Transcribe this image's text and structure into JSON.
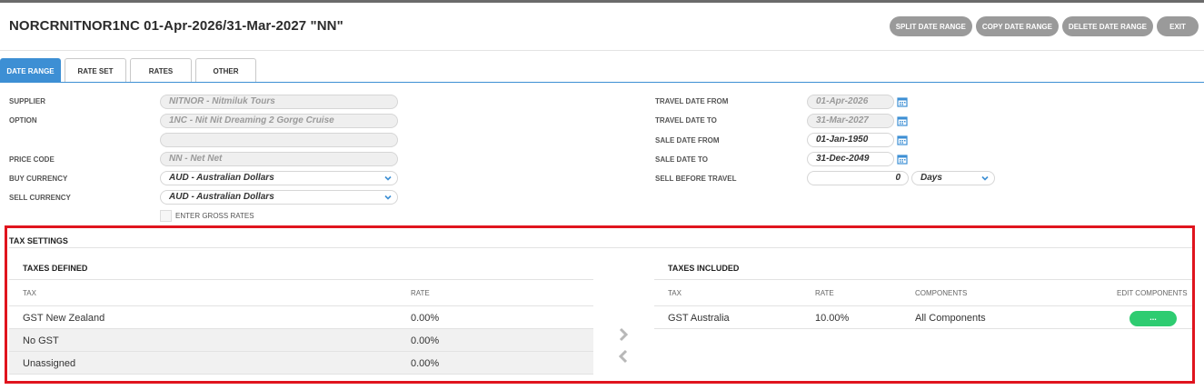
{
  "header": {
    "title": "NORCRNITNOR1NC 01-Apr-2026/31-Mar-2027 \"NN\"",
    "buttons": {
      "split": "SPLIT DATE RANGE",
      "copy": "COPY DATE RANGE",
      "delete": "DELETE DATE RANGE",
      "exit": "EXIT"
    }
  },
  "tabs": [
    "DATE RANGE",
    "RATE SET",
    "RATES",
    "OTHER"
  ],
  "form": {
    "supplier_label": "SUPPLIER",
    "supplier_value": "NITNOR - Nitmiluk Tours",
    "option_label": "OPTION",
    "option_value": "1NC - Nit Nit Dreaming 2 Gorge Cruise",
    "option_extra_value": "",
    "price_code_label": "PRICE CODE",
    "price_code_value": "NN - Net Net",
    "buy_currency_label": "BUY CURRENCY",
    "buy_currency_value": "AUD - Australian Dollars",
    "sell_currency_label": "SELL CURRENCY",
    "sell_currency_value": "AUD - Australian Dollars",
    "gross_rates_label": "ENTER GROSS RATES",
    "travel_from_label": "TRAVEL DATE FROM",
    "travel_from_value": "01-Apr-2026",
    "travel_to_label": "TRAVEL DATE TO",
    "travel_to_value": "31-Mar-2027",
    "sale_from_label": "SALE DATE FROM",
    "sale_from_value": "01-Jan-1950",
    "sale_to_label": "SALE DATE TO",
    "sale_to_value": "31-Dec-2049",
    "sell_before_label": "SELL BEFORE TRAVEL",
    "sell_before_value": "0",
    "sell_before_unit": "Days"
  },
  "tax_settings": {
    "title": "TAX SETTINGS",
    "defined": {
      "title": "TAXES DEFINED",
      "col_tax": "TAX",
      "col_rate": "RATE",
      "rows": [
        {
          "tax": "GST New Zealand",
          "rate": "0.00%"
        },
        {
          "tax": "No GST",
          "rate": "0.00%"
        },
        {
          "tax": "Unassigned",
          "rate": "0.00%"
        }
      ]
    },
    "included": {
      "title": "TAXES INCLUDED",
      "col_tax": "TAX",
      "col_rate": "RATE",
      "col_components": "COMPONENTS",
      "col_edit": "EDIT COMPONENTS",
      "rows": [
        {
          "tax": "GST Australia",
          "rate": "10.00%",
          "components": "All Components",
          "edit": "..."
        }
      ]
    }
  },
  "colors": {
    "accent": "#3d8fd4",
    "highlight_border": "#e0141e",
    "edit_button": "#2ecc71"
  }
}
